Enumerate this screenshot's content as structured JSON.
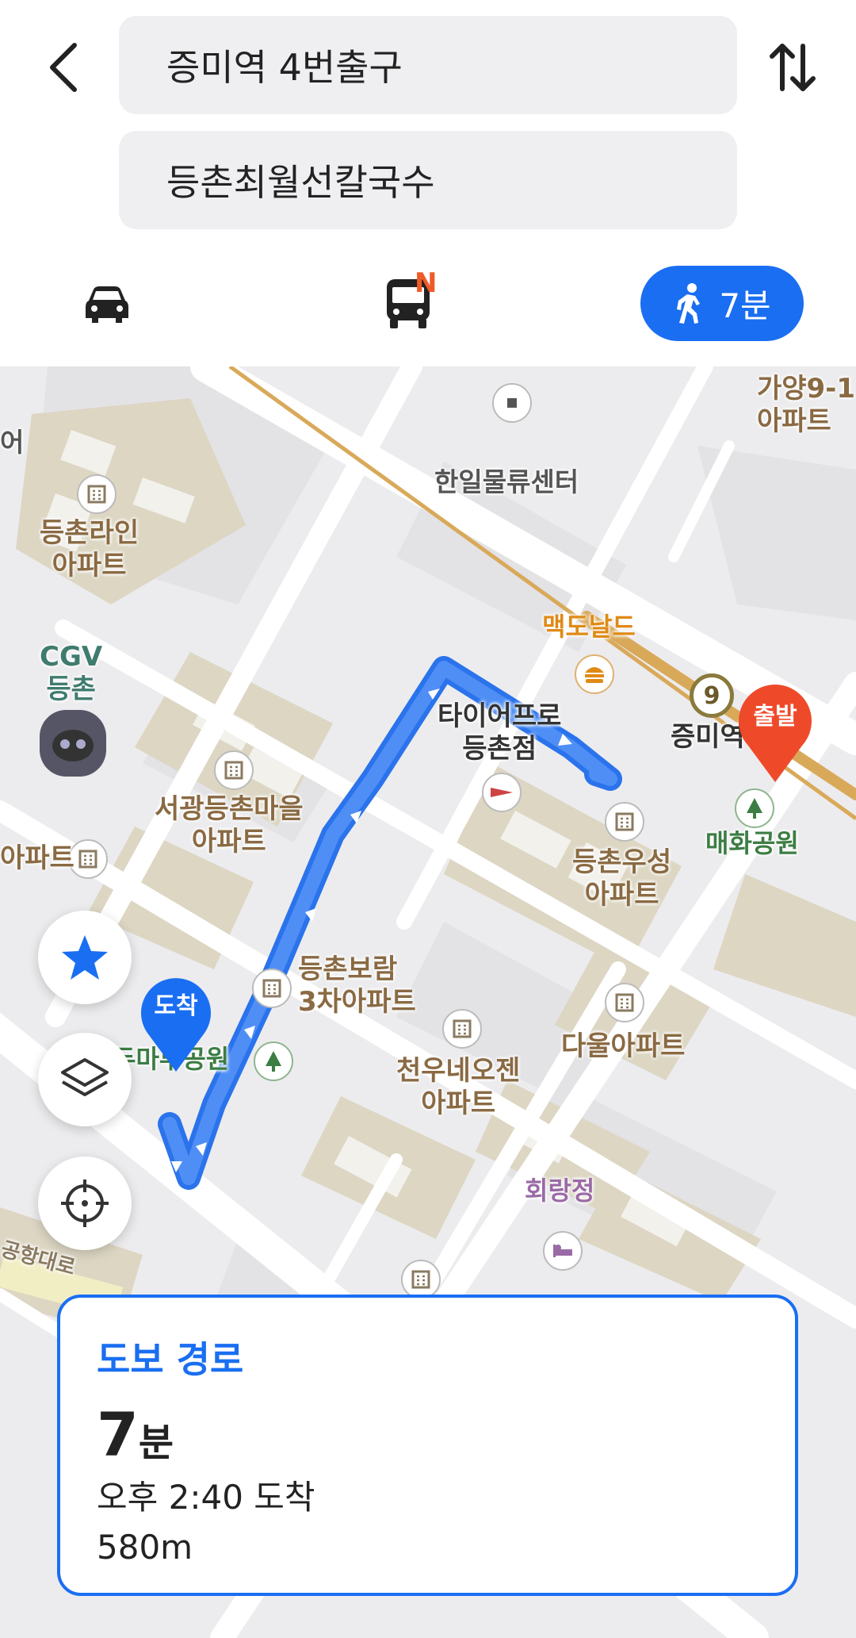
{
  "search": {
    "origin_value": "증미역 4번출구",
    "destination_value": "등촌최월선칼국수"
  },
  "modes": {
    "car_icon": "car-icon",
    "bus_icon": "bus-icon",
    "bus_badge": "N",
    "walk_label": "7분",
    "active": "walk",
    "accent_color": "#1a6ef2",
    "badge_color": "#f05a28"
  },
  "map": {
    "labels": {
      "apt_deungchon_line": "등촌라인\n아파트",
      "cgv": "CGV\n등촌",
      "hanil": "한일물류센터",
      "gayang": "가양9-1\n아파트",
      "mcdonalds": "맥도날드",
      "tire_pro": "타이어프로\n등촌점",
      "jeungmi_station": "증미역",
      "maehwa_park": "매화공원",
      "seogwang": "서광등촌마을\n아파트",
      "apt_left": "아파트",
      "deungchon_woosung": "등촌우성\n아파트",
      "boram": "등촌보람\n3차아파트",
      "daul": "다울아파트",
      "cheonwoo": "천우네오젠\n아파트",
      "dure_park": "두마루공원",
      "hoerangjeong": "회랑정",
      "airport_road": "공항대로",
      "left_edge": "어"
    },
    "start_pin": "출발",
    "end_pin": "도착",
    "station_line": "9"
  },
  "route_card": {
    "title": "도보 경로",
    "time_number": "7",
    "time_unit": "분",
    "arrival": "오후 2:40 도착",
    "distance": "580m"
  }
}
